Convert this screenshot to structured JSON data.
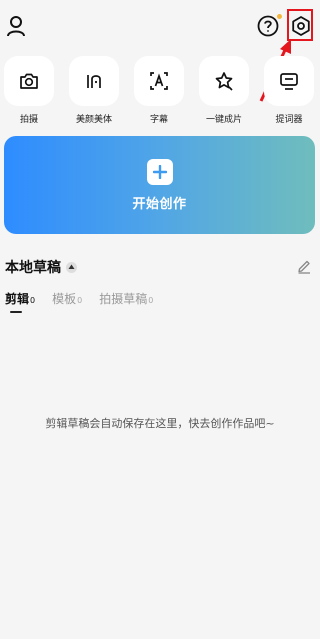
{
  "tools": [
    {
      "label": "拍摄",
      "icon": "camera-icon"
    },
    {
      "label": "美颜美体",
      "icon": "beauty-icon"
    },
    {
      "label": "字幕",
      "icon": "subtitle-icon"
    },
    {
      "label": "一键成片",
      "icon": "one-click-video-icon"
    },
    {
      "label": "提词器",
      "icon": "teleprompter-icon"
    }
  ],
  "start": {
    "label": "开始创作"
  },
  "drafts": {
    "title": "本地草稿",
    "tabs": [
      {
        "label": "剪辑",
        "count": "0"
      },
      {
        "label": "模板",
        "count": "0"
      },
      {
        "label": "拍摄草稿",
        "count": "0"
      }
    ],
    "empty_message": "剪辑草稿会自动保存在这里，快去创作作品吧~"
  },
  "colors": {
    "accent_start": "#2e8cff",
    "accent_end": "#6fbdbd",
    "highlight": "#e4161e",
    "notification_dot": "#f4b53d"
  }
}
